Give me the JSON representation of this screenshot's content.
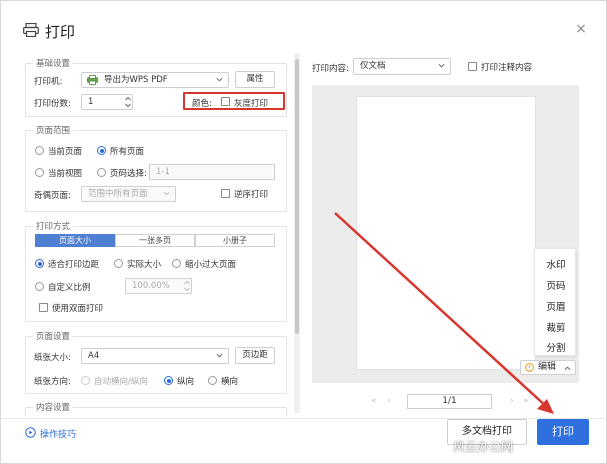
{
  "dialog": {
    "title": "打印",
    "close_label": "×"
  },
  "basic": {
    "legend": "基础设置",
    "printer_label": "打印机:",
    "printer_value": "导出为WPS PDF",
    "properties_label": "属性",
    "copies_label": "打印份数:",
    "copies_value": "1",
    "color_label": "颜色:",
    "grayscale_label": "灰度打印"
  },
  "range": {
    "legend": "页面范围",
    "current_page": "当前页面",
    "all_pages": "所有页面",
    "current_view": "当前视图",
    "page_select": "页码选择:",
    "page_select_placeholder": "1-1",
    "odd_even_label": "奇偶页面:",
    "odd_even_value": "范围中所有页面",
    "reverse_label": "逆序打印"
  },
  "mode": {
    "legend": "打印方式",
    "tabs": [
      "页面大小",
      "一张多页",
      "小册子"
    ],
    "fit_margins": "适合打印边距",
    "actual_size": "实际大小",
    "shrink": "缩小过大页面",
    "custom_scale": "自定义比例",
    "custom_scale_value": "100.00%",
    "duplex": "使用双面打印"
  },
  "page_setup": {
    "legend": "页面设置",
    "paper_size_label": "纸张大小:",
    "paper_size_value": "A4",
    "margins_button": "页边距",
    "orientation_label": "纸张方向:",
    "auto_orient": "自动横向/纵向",
    "portrait": "纵向",
    "landscape": "横向"
  },
  "content_settings": {
    "legend": "内容设置"
  },
  "preview": {
    "content_label": "打印内容:",
    "content_value": "仅文档",
    "annotations_label": "打印注释内容",
    "side_menu": [
      "水印",
      "页码",
      "页眉",
      "裁剪",
      "分割"
    ],
    "edit_label": "编辑",
    "page_indicator": "1/1"
  },
  "footer": {
    "tips_label": "操作技巧",
    "multi_doc_label": "多文档打印",
    "print_label": "打印"
  },
  "watermark_text": "风云办公网",
  "colors": {
    "accent": "#2f6fde",
    "highlight_box": "#d6362d",
    "arrow": "#d6362d"
  }
}
